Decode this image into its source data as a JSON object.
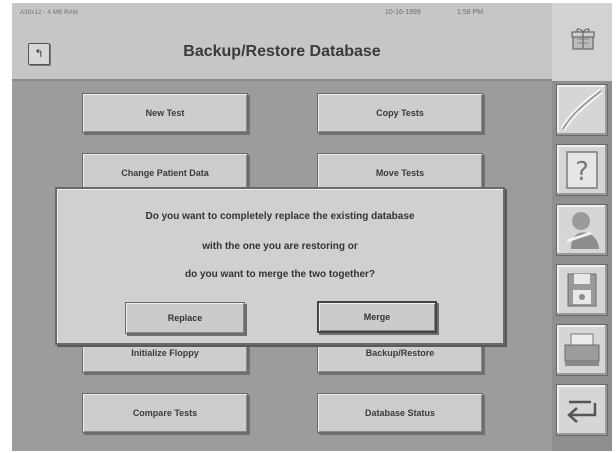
{
  "status": {
    "device": "A30x12 - 4 MB RAM",
    "date": "10-16-1999",
    "time": "1:58 PM"
  },
  "header": {
    "title": "Backup/Restore Database",
    "back_icon": "back-arrow-icon"
  },
  "main_buttons": {
    "new_test": "New Test",
    "copy_tests": "Copy Tests",
    "change_patient_data": "Change Patient Data",
    "move_tests": "Move Tests",
    "initialize_floppy": "Initialize Floppy",
    "backup_restore": "Backup/Restore",
    "compare_tests": "Compare Tests",
    "database_status": "Database Status"
  },
  "dialog": {
    "line1": "Do you want to completely replace the existing database",
    "line2": "with the one you are restoring or",
    "line3": "do you want to merge the two together?",
    "replace_label": "Replace",
    "merge_label": "Merge",
    "selected": "Merge"
  },
  "toolbar": {
    "items": [
      "curve-icon",
      "help-icon",
      "patient-icon",
      "floppy-disk-icon",
      "printer-icon",
      "return-icon"
    ]
  },
  "colors": {
    "background": "#9c9c9c",
    "button": "#cdcdcd",
    "header": "#c6c6c6"
  }
}
